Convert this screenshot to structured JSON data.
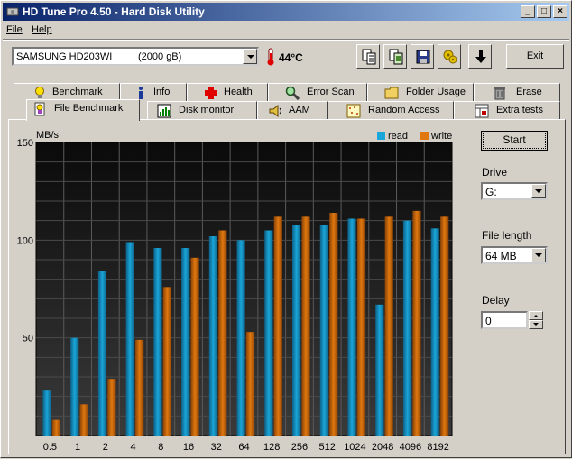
{
  "window": {
    "title": "HD Tune Pro 4.50 - Hard Disk Utility",
    "controls": {
      "minimize": "_",
      "maximize": "□",
      "close": "×"
    }
  },
  "menu": {
    "file": "File",
    "help": "Help"
  },
  "toolbar": {
    "drive_model": "SAMSUNG HD203WI",
    "drive_capacity": "(2000 gB)",
    "temperature": "44°C",
    "exit_label": "Exit",
    "icons": [
      "copy-text-icon",
      "copy-screenshot-icon",
      "save-icon",
      "options-icon",
      "download-icon"
    ]
  },
  "tabs": {
    "row1": [
      {
        "label": "Benchmark",
        "icon": "lightbulb-icon"
      },
      {
        "label": "Info",
        "icon": "info-icon"
      },
      {
        "label": "Health",
        "icon": "health-cross-icon"
      },
      {
        "label": "Error Scan",
        "icon": "magnifier-icon"
      },
      {
        "label": "Folder Usage",
        "icon": "folder-icon"
      },
      {
        "label": "Erase",
        "icon": "trash-icon"
      }
    ],
    "row2": [
      {
        "label": "File Benchmark",
        "icon": "file-benchmark-icon",
        "active": true
      },
      {
        "label": "Disk monitor",
        "icon": "disk-monitor-icon"
      },
      {
        "label": "AAM",
        "icon": "speaker-icon"
      },
      {
        "label": "Random Access",
        "icon": "random-access-icon"
      },
      {
        "label": "Extra tests",
        "icon": "extra-tests-icon"
      }
    ]
  },
  "side": {
    "start_label": "Start",
    "drive_label": "Drive",
    "drive_value": "G:",
    "file_length_label": "File length",
    "file_length_value": "64 MB",
    "delay_label": "Delay",
    "delay_value": "0"
  },
  "colors": {
    "read": "#1aa6d8",
    "write": "#e0780f",
    "plot_bg_top": "#0a0a0a",
    "plot_bg_bottom": "#3a3a3a"
  },
  "chart_data": {
    "type": "bar",
    "ylabel": "MB/s",
    "ylim": [
      0,
      150
    ],
    "yticks": [
      50,
      100,
      150
    ],
    "categories": [
      "0.5",
      "1",
      "2",
      "4",
      "8",
      "16",
      "32",
      "64",
      "128",
      "256",
      "512",
      "1024",
      "2048",
      "4096",
      "8192"
    ],
    "series": [
      {
        "name": "read",
        "values": [
          23,
          50,
          84,
          99,
          96,
          96,
          102,
          100,
          105,
          108,
          108,
          111,
          67,
          110,
          106
        ]
      },
      {
        "name": "write",
        "values": [
          8,
          16,
          29,
          49,
          76,
          91,
          105,
          53,
          112,
          112,
          114,
          111,
          112,
          115,
          112
        ]
      }
    ],
    "legend": "top-right",
    "grid": true
  }
}
